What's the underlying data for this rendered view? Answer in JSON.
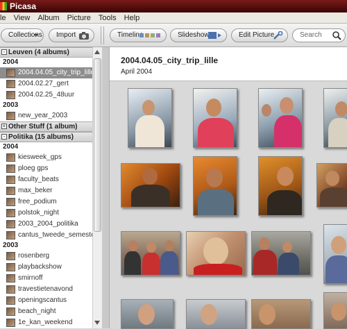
{
  "app": {
    "title": "Picasa"
  },
  "menu": [
    "le",
    "View",
    "Album",
    "Picture",
    "Tools",
    "Help"
  ],
  "toolbar": {
    "collections": "Collections",
    "import": "Import",
    "timeline": "Timeline",
    "slideshow": "Slideshow",
    "edit": "Edit Picture",
    "search_placeholder": "Search"
  },
  "sidebar": {
    "groups": [
      {
        "label": "Leuven (4 albums)",
        "toggle": "-"
      },
      {
        "label": "Other Stuff (1 album)",
        "toggle": "+"
      },
      {
        "label": "Politika (15 albums)",
        "toggle": "-"
      }
    ],
    "years": [
      "2004",
      "2003",
      "2004",
      "2003"
    ],
    "albums": [
      "2004.04.05_city_trip_lille",
      "2004.02.27_gert",
      "2004.02.25_48uur",
      "new_year_2003",
      "kiesweek_gps",
      "ploeg gps",
      "faculty_beats",
      "max_beker",
      "free_podium",
      "polstok_night",
      "2003_2004_politika",
      "cantus_tweede_semester",
      "rosenberg",
      "playbackshow",
      "smirnoff",
      "travestietenavond",
      "openingscantus",
      "beach_night",
      "1e_kan_weekend"
    ]
  },
  "main": {
    "album_title": "2004.04.05_city_trip_lille",
    "album_date": "April 2004"
  },
  "colors": {
    "titlebar": "#5a0d0d",
    "selected": "#8d8d8d"
  }
}
